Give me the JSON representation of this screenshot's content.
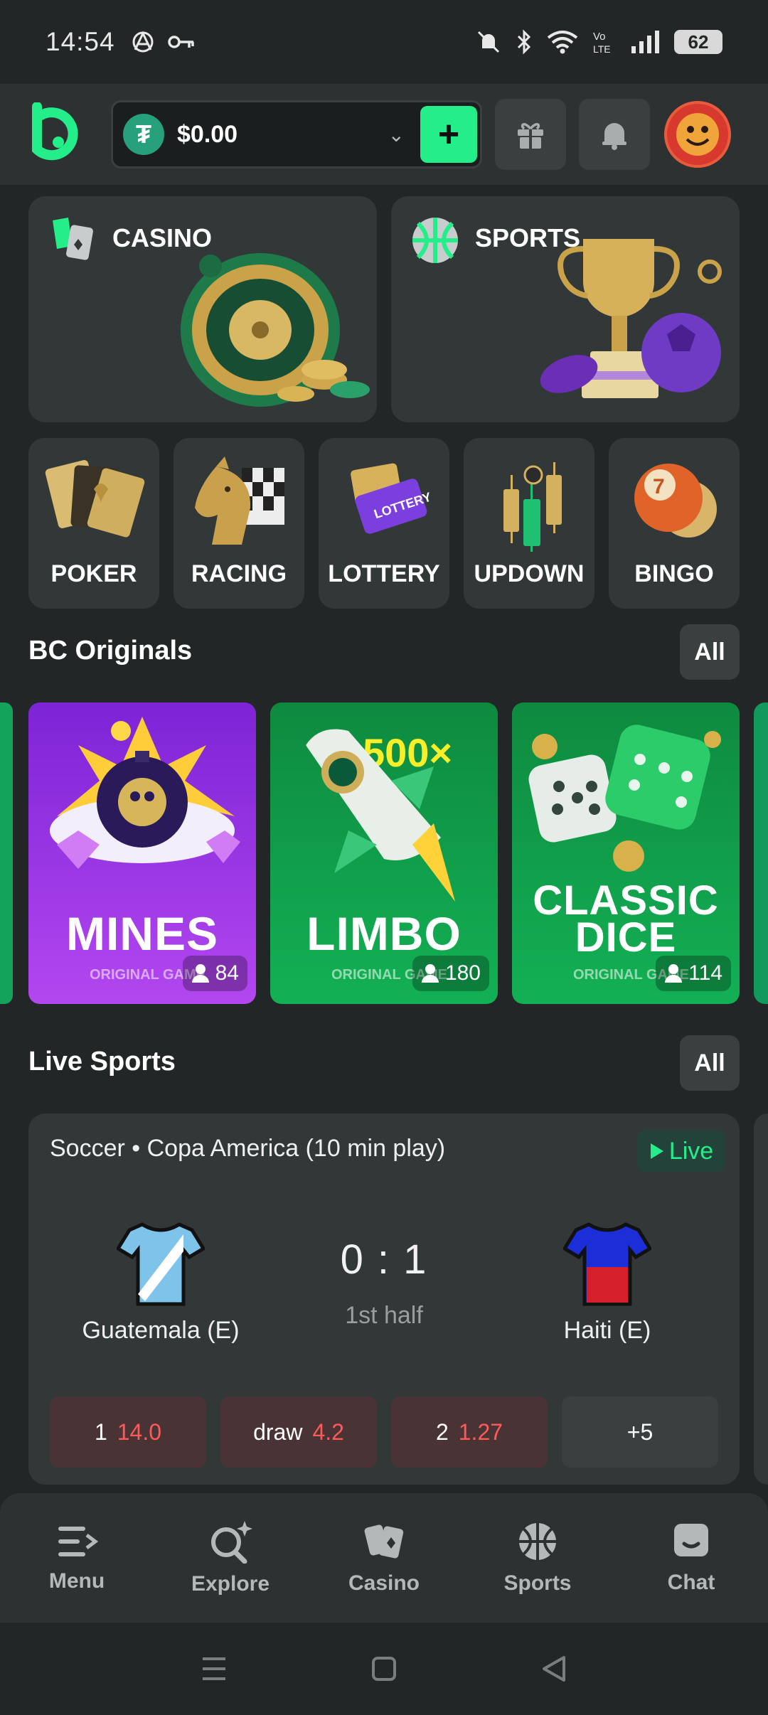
{
  "status": {
    "time": "14:54",
    "battery": "62"
  },
  "header": {
    "balance": "$0.00",
    "currency_icon": "tether-usdt-icon",
    "deposit_label": "+"
  },
  "categories": {
    "casino": "CASINO",
    "sports": "SPORTS"
  },
  "tiles": [
    {
      "label": "POKER"
    },
    {
      "label": "RACING"
    },
    {
      "label": "LOTTERY"
    },
    {
      "label": "UPDOWN"
    },
    {
      "label": "BINGO"
    }
  ],
  "originals": {
    "title": "BC Originals",
    "all_label": "All",
    "games": [
      {
        "name": "MINES",
        "sub": "ORIGINAL GAME",
        "players": "84",
        "color": "#9b2de6"
      },
      {
        "name": "LIMBO",
        "sub": "ORIGINAL GAME",
        "players": "180",
        "color": "#0f9a48",
        "badge": "500×"
      },
      {
        "name_line1": "CLASSIC",
        "name_line2": "DICE",
        "sub": "ORIGINAL GAME",
        "players": "114",
        "color": "#0f9a48"
      }
    ]
  },
  "live_sports": {
    "title": "Live Sports",
    "all_label": "All",
    "match": {
      "league": "Soccer • Copa America (10 min play)",
      "live_label": "Live",
      "home": "Guatemala (E)",
      "away": "Haiti (E)",
      "score": "0 : 1",
      "period": "1st half",
      "odds": [
        {
          "label": "1",
          "value": "14.0"
        },
        {
          "label": "draw",
          "value": "4.2"
        },
        {
          "label": "2",
          "value": "1.27"
        }
      ],
      "more": "+5"
    }
  },
  "nav": [
    {
      "label": "Menu",
      "icon": "menu-icon"
    },
    {
      "label": "Explore",
      "icon": "explore-icon"
    },
    {
      "label": "Casino",
      "icon": "casino-cards-icon"
    },
    {
      "label": "Sports",
      "icon": "basketball-icon"
    },
    {
      "label": "Chat",
      "icon": "chat-icon"
    }
  ],
  "colors": {
    "accent": "#24ee89",
    "background": "#232626",
    "card": "#323738",
    "odds_red": "#ff5a5a"
  }
}
